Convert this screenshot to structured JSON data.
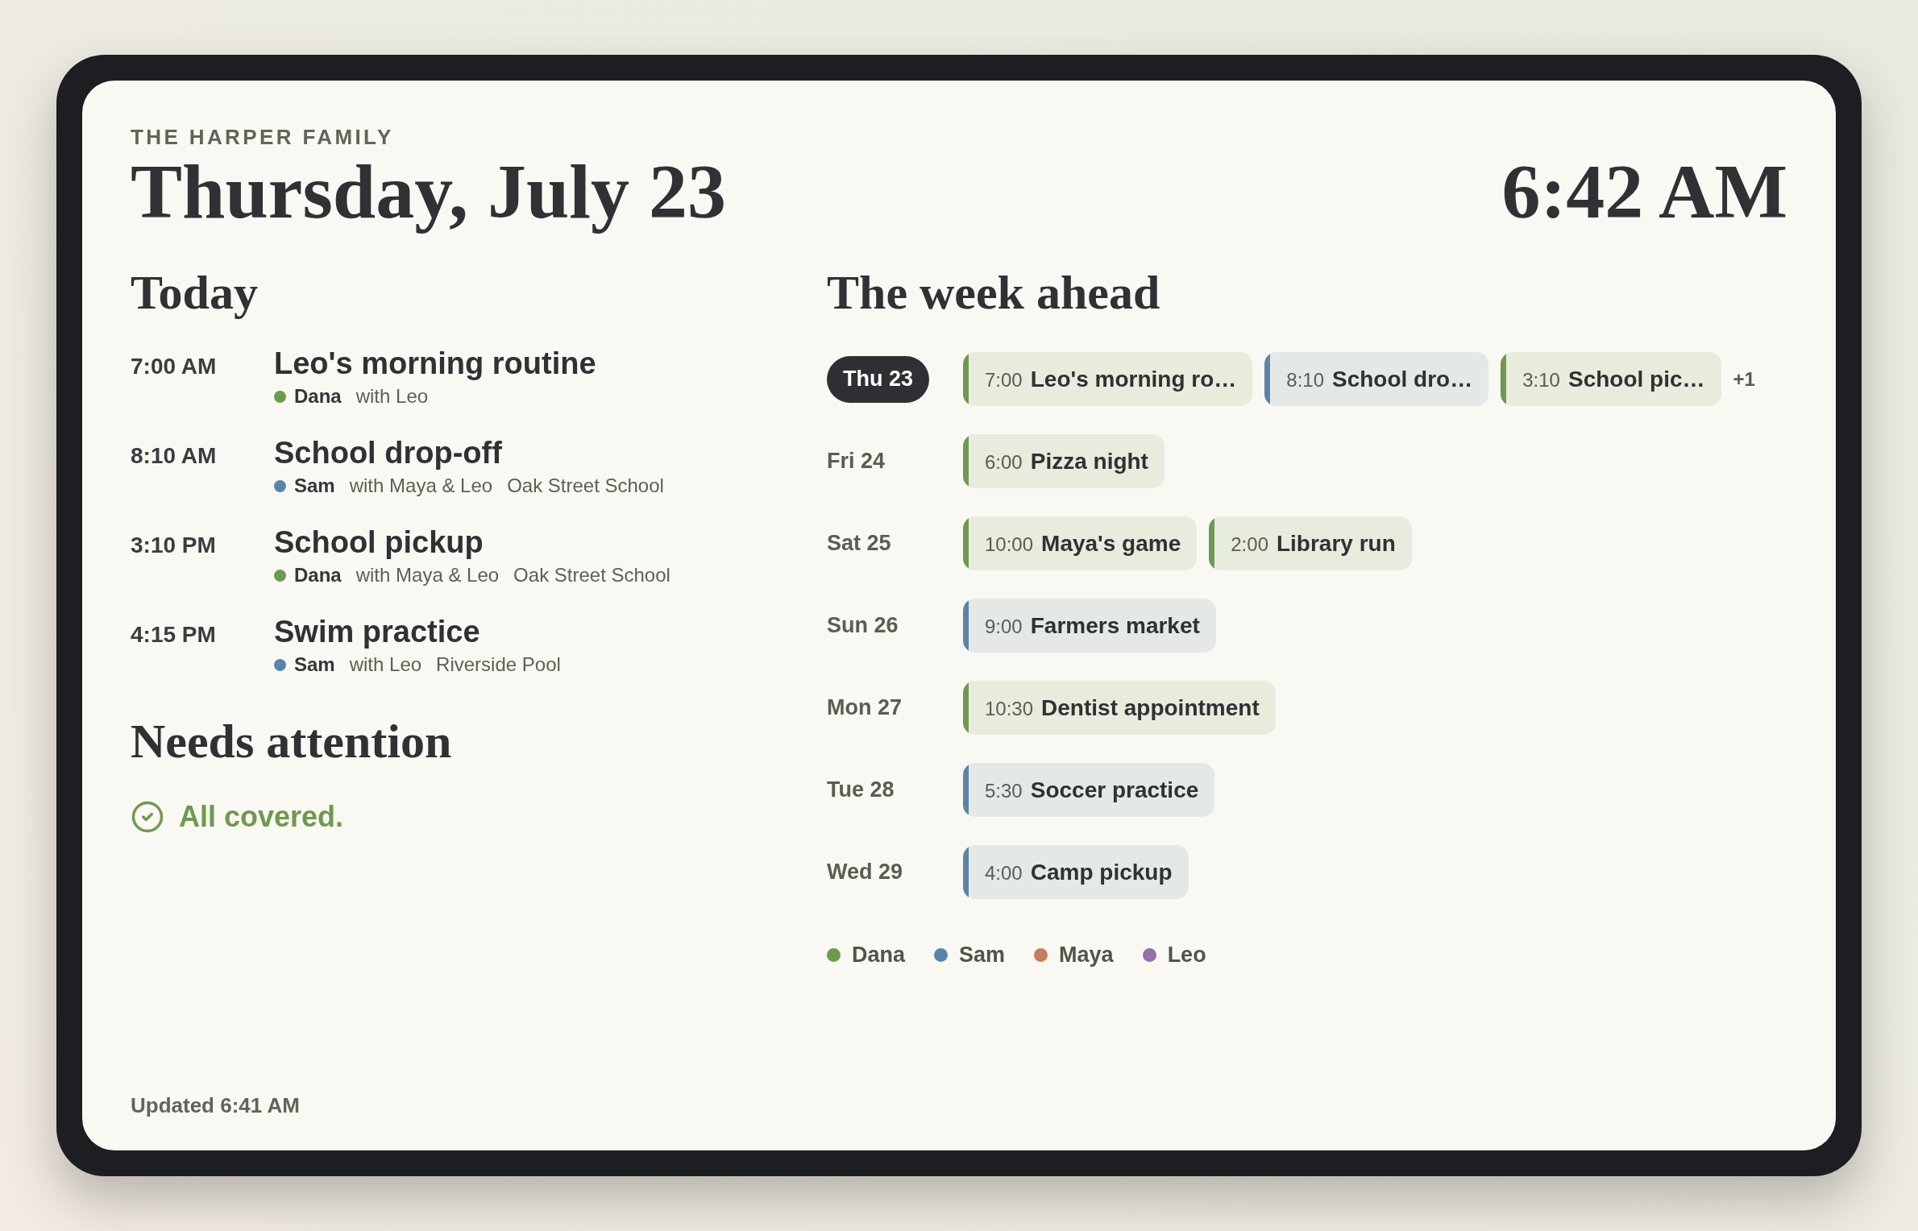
{
  "header": {
    "family": "THE HARPER FAMILY",
    "date": "Thursday, July 23",
    "time": "6:42 AM"
  },
  "today": {
    "title": "Today",
    "events": [
      {
        "time": "7:00 AM",
        "title": "Leo's morning routine",
        "person": "Dana",
        "color": "#6e9a50",
        "with": "with Leo"
      },
      {
        "time": "8:10 AM",
        "title": "School drop-off",
        "person": "Sam",
        "color": "#5a85a8",
        "with": "with Maya & Leo",
        "place": "Oak Street School"
      },
      {
        "time": "3:10 PM",
        "title": "School pickup",
        "person": "Dana",
        "color": "#6e9a50",
        "with": "with Maya & Leo",
        "place": "Oak Street School"
      },
      {
        "time": "4:15 PM",
        "title": "Swim practice",
        "person": "Sam",
        "color": "#5a85a8",
        "with": "with Leo",
        "place": "Riverside Pool"
      }
    ]
  },
  "attention": {
    "title": "Needs attention",
    "status": "All covered."
  },
  "week": {
    "title": "The week ahead",
    "days": [
      {
        "label": "Thu 23",
        "selected": true,
        "events": [
          {
            "time": "7:00",
            "title": "Leo's morning ro…",
            "color": "#6e9a50"
          },
          {
            "time": "8:10",
            "title": "School dro…",
            "color": "#5a85a8"
          },
          {
            "time": "3:10",
            "title": "School pic…",
            "color": "#6e9a50"
          }
        ],
        "more": "+1"
      },
      {
        "label": "Fri 24",
        "selected": false,
        "events": [
          {
            "time": "6:00",
            "title": "Pizza night",
            "color": "#6e9a50"
          }
        ]
      },
      {
        "label": "Sat 25",
        "selected": false,
        "events": [
          {
            "time": "10:00",
            "title": "Maya's game",
            "color": "#6e9a50"
          },
          {
            "time": "2:00",
            "title": "Library run",
            "color": "#6e9a50"
          }
        ]
      },
      {
        "label": "Sun 26",
        "selected": false,
        "events": [
          {
            "time": "9:00",
            "title": "Farmers market",
            "color": "#5a85a8"
          }
        ]
      },
      {
        "label": "Mon 27",
        "selected": false,
        "events": [
          {
            "time": "10:30",
            "title": "Dentist appointment",
            "color": "#6e9a50"
          }
        ]
      },
      {
        "label": "Tue 28",
        "selected": false,
        "events": [
          {
            "time": "5:30",
            "title": "Soccer practice",
            "color": "#5a85a8"
          }
        ]
      },
      {
        "label": "Wed 29",
        "selected": false,
        "events": [
          {
            "time": "4:00",
            "title": "Camp pickup",
            "color": "#5a85a8"
          }
        ]
      }
    ],
    "legend": [
      {
        "name": "Dana",
        "color": "#6e9a50"
      },
      {
        "name": "Sam",
        "color": "#5a85a8"
      },
      {
        "name": "Maya",
        "color": "#c47e5c"
      },
      {
        "name": "Leo",
        "color": "#9470a6"
      }
    ]
  },
  "updated": "Updated 6:41 AM"
}
